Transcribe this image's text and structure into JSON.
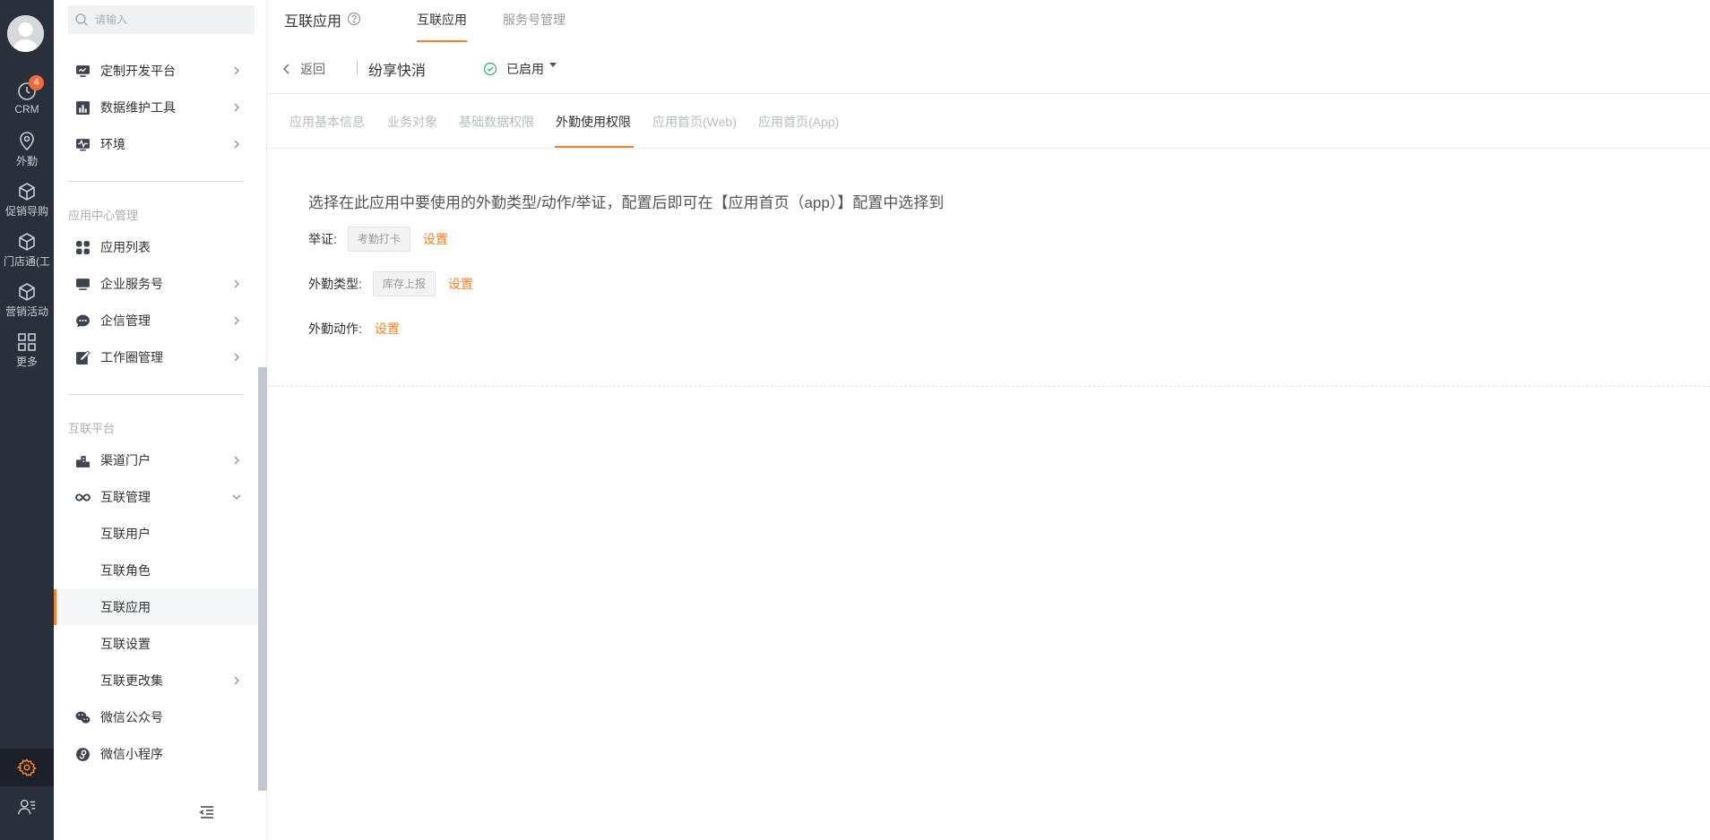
{
  "rail": {
    "items": [
      {
        "label": "CRM",
        "icon": "clock-icon",
        "badge": "4"
      },
      {
        "label": "外勤",
        "icon": "location-pin-icon"
      },
      {
        "label": "促销导购",
        "icon": "cube-icon"
      },
      {
        "label": "门店通(工",
        "icon": "cube-icon"
      },
      {
        "label": "营销活动",
        "icon": "cube-icon"
      },
      {
        "label": "更多",
        "icon": "grid-icon"
      }
    ],
    "active_color": "#f5822b"
  },
  "sidebar": {
    "search_placeholder": "请输入",
    "items_top": [
      {
        "label": "定制开发平台",
        "icon": "monitor-icon"
      },
      {
        "label": "数据维护工具",
        "icon": "bar-chart-icon"
      },
      {
        "label": "环境",
        "icon": "pulse-icon"
      }
    ],
    "group1_title": "应用中心管理",
    "group1": [
      {
        "label": "应用列表",
        "icon": "apps-icon"
      },
      {
        "label": "企业服务号",
        "icon": "screen-icon"
      },
      {
        "label": "企信管理",
        "icon": "chat-icon"
      },
      {
        "label": "工作圈管理",
        "icon": "edit-square-icon"
      }
    ],
    "group2_title": "互联平台",
    "group2": [
      {
        "label": "渠道门户",
        "icon": "building-icon"
      },
      {
        "label": "互联管理",
        "icon": "infinity-icon"
      }
    ],
    "sub": [
      {
        "label": "互联用户"
      },
      {
        "label": "互联角色"
      },
      {
        "label": "互联应用"
      },
      {
        "label": "互联设置"
      },
      {
        "label": "互联更改集"
      }
    ],
    "bottom": [
      {
        "label": "微信公众号",
        "icon": "wechat-icon"
      },
      {
        "label": "微信小程序",
        "icon": "mini-program-icon"
      }
    ]
  },
  "header": {
    "title": "互联应用",
    "tabs": [
      "互联应用",
      "服务号管理"
    ]
  },
  "subbar": {
    "back": "返回",
    "app_name": "纷享快消",
    "status": "已启用"
  },
  "tabs": [
    "应用基本信息",
    "业务对象",
    "基础数据权限",
    "外勤使用权限",
    "应用首页(Web)",
    "应用首页(App)"
  ],
  "content": {
    "intro": "选择在此应用中要使用的外勤类型/动作/举证，配置后即可在【应用首页（app）】配置中选择到",
    "rows": [
      {
        "label": "举证:",
        "tag": "考勤打卡",
        "action": "设置"
      },
      {
        "label": "外勤类型:",
        "tag": "库存上报",
        "action": "设置"
      },
      {
        "label": "外勤动作:",
        "action": "设置"
      }
    ]
  }
}
